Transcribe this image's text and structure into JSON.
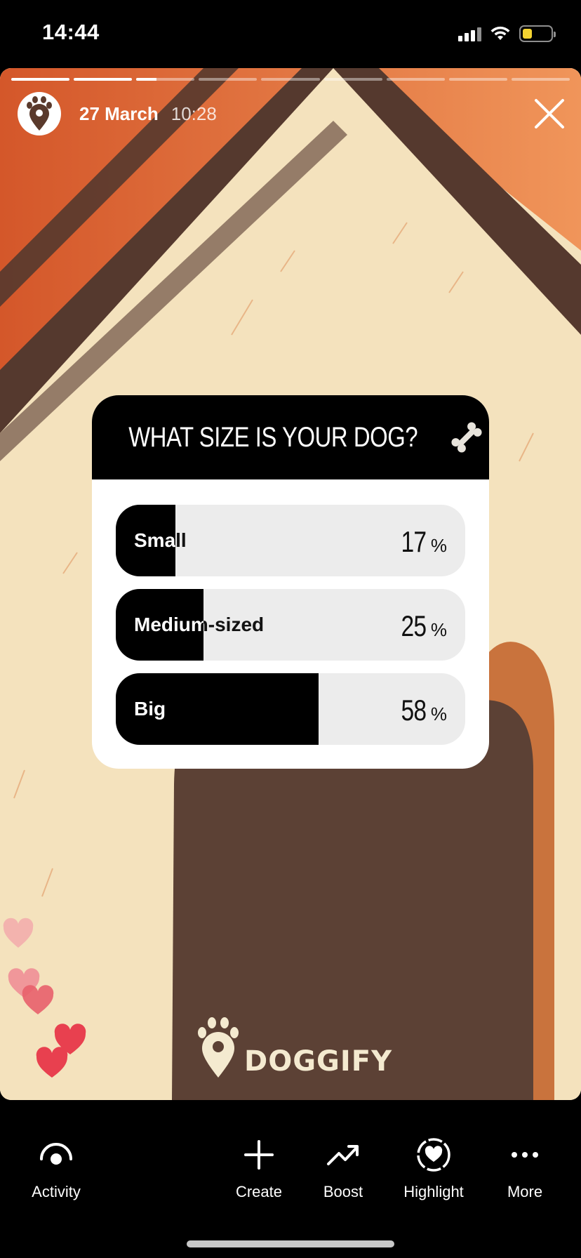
{
  "status_bar": {
    "time": "14:44",
    "battery_color": "#f4d431"
  },
  "story": {
    "date": "27 March",
    "time": "10:28",
    "progress_segments": [
      1,
      1,
      0.35,
      0,
      0,
      0,
      0,
      0,
      0
    ],
    "account_icon": "paw-pin-icon"
  },
  "poll": {
    "question": "WHAT SIZE IS YOUR DOG?",
    "question_icon": "bone-icon",
    "options": [
      {
        "label": "Small",
        "percent": "17",
        "fraction": 0.17
      },
      {
        "label": "Medium-sized",
        "percent": "25",
        "fraction": 0.25
      },
      {
        "label": "Big",
        "percent": "58",
        "fraction": 0.58
      }
    ],
    "percent_sign": "%"
  },
  "brand": {
    "logo_text": "DOGGIFY"
  },
  "actions": [
    {
      "label": "Activity",
      "icon": "activity-eye-icon"
    },
    {
      "label": "Create",
      "icon": "plus-icon"
    },
    {
      "label": "Boost",
      "icon": "trend-up-icon"
    },
    {
      "label": "Highlight",
      "icon": "highlight-heart-icon"
    },
    {
      "label": "More",
      "icon": "more-dots-icon"
    }
  ],
  "colors": {
    "roof_orange": "#d9622b",
    "roof_dark": "#55392e",
    "wall_cream": "#f4e2bd",
    "door_brown": "#5c4135",
    "heart_red": "#e8404f"
  }
}
